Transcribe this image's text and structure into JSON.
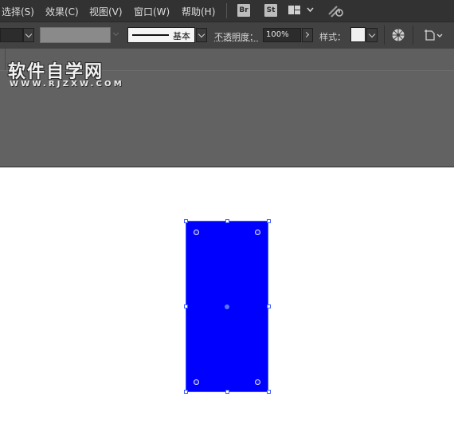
{
  "menubar": {
    "items": [
      "选择(S)",
      "效果(C)",
      "视图(V)",
      "窗口(W)",
      "帮助(H)"
    ],
    "bridge_badge": "Br",
    "stock_badge": "St"
  },
  "controlbar": {
    "stroke_style_label": "基本",
    "opacity_label": "不透明度：",
    "opacity_value": "100%",
    "style_label": "样式："
  },
  "watermark": {
    "title": "软件自学网",
    "url": "WWW.RJZXW.COM"
  },
  "canvas": {
    "shape_fill": "#0000ff",
    "selection_color": "#3355ff"
  }
}
